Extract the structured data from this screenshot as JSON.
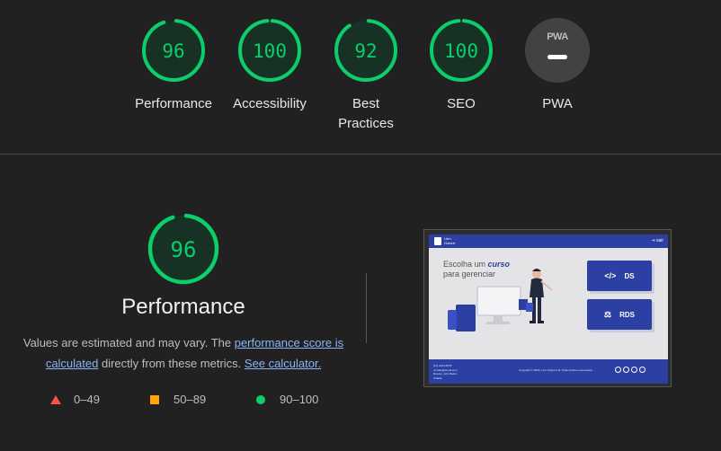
{
  "colors": {
    "pass": "#0cce6b",
    "average": "#ffa400",
    "fail": "#ff4e42",
    "background": "#212121"
  },
  "gauges": [
    {
      "label": "Performance",
      "score": "96",
      "fraction": 0.96
    },
    {
      "label": "Accessibility",
      "score": "100",
      "fraction": 1.0
    },
    {
      "label": "Best Practices",
      "score": "92",
      "fraction": 0.92
    },
    {
      "label": "SEO",
      "score": "100",
      "fraction": 1.0
    }
  ],
  "pwa": {
    "label": "PWA",
    "badge": "PWA"
  },
  "performance": {
    "score": "96",
    "fraction": 0.96,
    "title": "Performance",
    "desc_prefix": "Values are estimated and may vary. The ",
    "desc_link1": "performance score is calculated",
    "desc_middle": " directly from these metrics. ",
    "desc_link2": "See calculator."
  },
  "legend": {
    "fail": "0–49",
    "average": "50–89",
    "pass": "90–100"
  },
  "thumbnail": {
    "brand_line1": "Lien",
    "brand_line2": "Gobert",
    "exit_label": "sair",
    "heading_prefix": "Escolha um ",
    "heading_emphasis": "curso",
    "heading_line2": "para gerenciar",
    "button_ds": "DS",
    "button_rds": "RDS",
    "footer_line1": "(11) 1234-5678",
    "footer_line2": "contato@email.com",
    "footer_line3": "Rua Ex, 123, Bairro",
    "footer_line4": "Cidade",
    "copyright": "Copyright © 2023, Lien Gobert e E. Todos direitos reservados"
  }
}
